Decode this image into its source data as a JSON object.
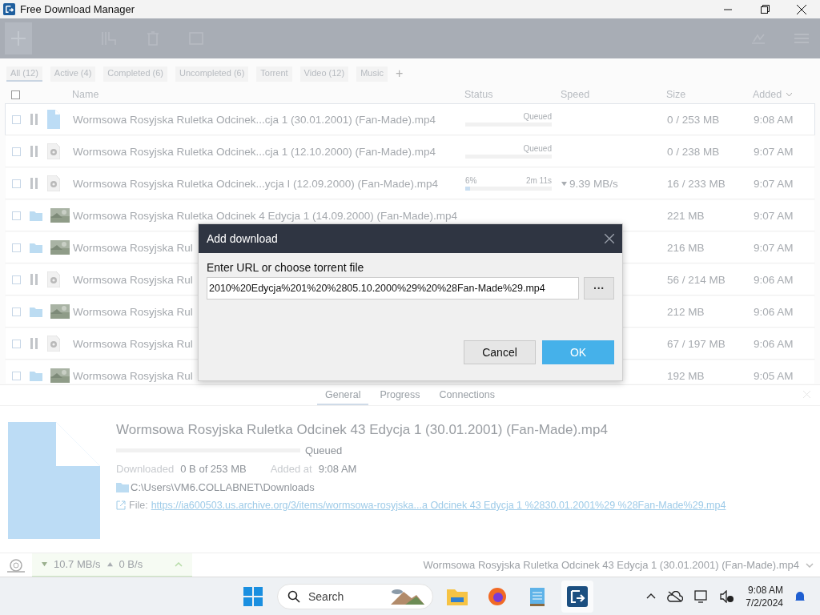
{
  "window": {
    "title": "Free Download Manager"
  },
  "filters": [
    {
      "label": "All (12)",
      "selected": true
    },
    {
      "label": "Active (4)",
      "selected": false
    },
    {
      "label": "Completed (6)",
      "selected": false
    },
    {
      "label": "Uncompleted (6)",
      "selected": false
    },
    {
      "label": "Torrent",
      "selected": false
    },
    {
      "label": "Video (12)",
      "selected": false
    },
    {
      "label": "Music",
      "selected": false
    }
  ],
  "add_filter": "+",
  "table": {
    "select_all": {
      "checked": false
    },
    "columns": [
      "Name",
      "Status",
      "Speed",
      "Size",
      "Added"
    ],
    "rows": [
      {
        "kind": "active",
        "selected": true,
        "name": "Wormsowa Rosyjska Ruletka Odcinek...cja 1 (30.01.2001) (Fan-Made).mp4",
        "status": "Queued",
        "size": "0 / 253 MB",
        "added": "9:08 AM"
      },
      {
        "kind": "active",
        "selected": false,
        "name": "Wormsowa Rosyjska Ruletka Odcinek...cja 1 (12.10.2000) (Fan-Made).mp4",
        "status": "Queued",
        "size": "0 / 238 MB",
        "added": "9:07 AM"
      },
      {
        "kind": "active",
        "selected": false,
        "name": "Wormsowa Rosyjska Ruletka Odcinek...ycja I (12.09.2000) (Fan-Made).mp4",
        "percent": "6%",
        "remaining": "2m 11s",
        "level": 0.06,
        "speed": "9.39 MB/s",
        "size": "16 / 233 MB",
        "added": "9:07 AM"
      },
      {
        "kind": "completed",
        "selected": false,
        "name": "Wormsowa Rosyjska Ruletka Odcinek 4 Edycja 1 (14.09.2000) (Fan-Made).mp4",
        "size": "221 MB",
        "added": "9:07 AM"
      },
      {
        "kind": "completed",
        "selected": false,
        "name": "Wormsowa Rosyjska Rul",
        "size": "216 MB",
        "added": "9:07 AM"
      },
      {
        "kind": "active",
        "selected": false,
        "name": "Wormsowa Rosyjska Rul",
        "size": "56 / 214 MB",
        "added": "9:06 AM"
      },
      {
        "kind": "completed",
        "selected": false,
        "name": "Wormsowa Rosyjska Rul",
        "size": "212 MB",
        "added": "9:06 AM"
      },
      {
        "kind": "active",
        "selected": false,
        "name": "Wormsowa Rosyjska Rul",
        "size": "67 / 197 MB",
        "added": "9:06 AM"
      },
      {
        "kind": "completed",
        "selected": false,
        "name": "Wormsowa Rosyjska Rul",
        "size": "192 MB",
        "added": "9:05 AM"
      }
    ]
  },
  "dialog": {
    "title": "Add download",
    "label": "Enter URL or choose torrent file",
    "url": "2010%20Edycja%201%20%2805.10.2000%29%20%28Fan-Made%29.mp4",
    "browse": "···",
    "buttons": [
      "Cancel",
      "OK"
    ]
  },
  "details": {
    "tabs": [
      {
        "label": "General",
        "selected": true
      },
      {
        "label": "Progress",
        "selected": false
      },
      {
        "label": "Connections",
        "selected": false
      }
    ],
    "title": "Wormsowa Rosyjska Ruletka Odcinek 43 Edycja 1 (30.01.2001) (Fan-Made).mp4",
    "status": "Queued",
    "downloaded_label": "Downloaded",
    "downloaded": "0 B of 253 MB",
    "added_label": "Added at",
    "added": "9:08 AM",
    "folder": "C:\\Users\\VM6.COLLABNET\\Downloads",
    "file_label": "File:",
    "file_url": "https://ia600503.us.archive.org/3/items/wormsowa-rosyjska...a Odcinek 43 Edycja 1 %2830.01.2001%29 %28Fan-Made%29.mp4"
  },
  "status_bar": {
    "down": "10.7 MB/s",
    "up": "0 B/s",
    "current": "Wormsowa Rosyjska Ruletka Odcinek 43 Edycja 1 (30.01.2001) (Fan-Made).mp4"
  },
  "taskbar": {
    "search": "Search",
    "time": "9:08 AM",
    "date": "7/2/2024"
  }
}
